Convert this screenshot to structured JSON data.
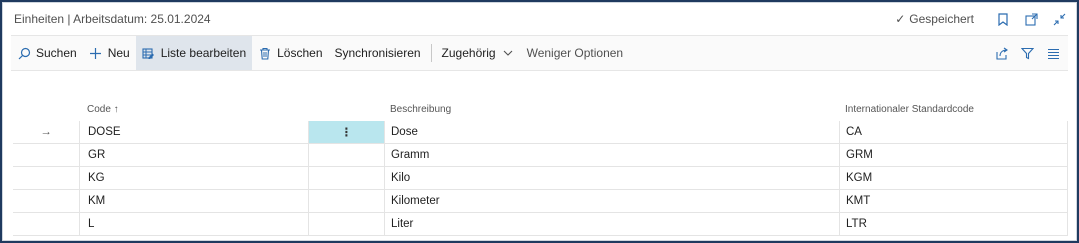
{
  "titlebar": {
    "title": "Einheiten | Arbeitsdatum: 25.01.2024",
    "saved_label": "Gespeichert"
  },
  "actions": {
    "search": "Suchen",
    "new": "Neu",
    "edit_list": "Liste bearbeiten",
    "delete": "Löschen",
    "sync": "Synchronisieren",
    "related": "Zugehörig",
    "fewer_options": "Weniger Optionen"
  },
  "table": {
    "columns": {
      "code": "Code ↑",
      "description": "Beschreibung",
      "intl_code": "Internationaler Standardcode"
    },
    "rows": [
      {
        "code": "DOSE",
        "description": "Dose",
        "intl_code": "CA"
      },
      {
        "code": "GR",
        "description": "Gramm",
        "intl_code": "GRM"
      },
      {
        "code": "KG",
        "description": "Kilo",
        "intl_code": "KGM"
      },
      {
        "code": "KM",
        "description": "Kilometer",
        "intl_code": "KMT"
      },
      {
        "code": "L",
        "description": "Liter",
        "intl_code": "LTR"
      }
    ],
    "row_menu_glyph": "⋮",
    "selected_marker": "→"
  }
}
